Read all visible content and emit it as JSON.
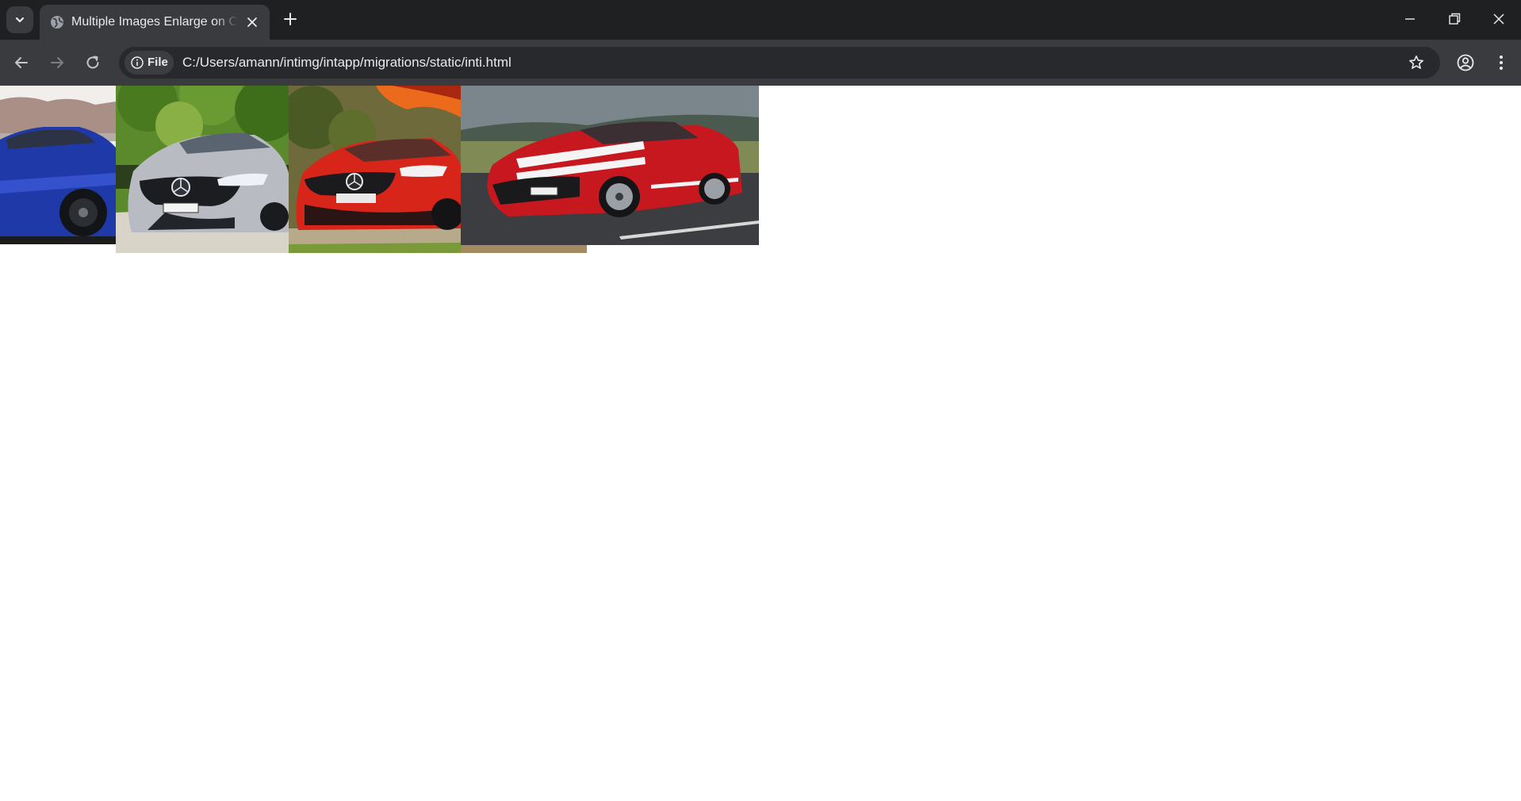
{
  "browser": {
    "tab_title": "Multiple Images Enlarge on Click",
    "address_chip_label": "File",
    "url": "C:/Users/amann/intimg/intapp/migrations/static/inti.html",
    "icons": [
      "chevron-down-icon",
      "globe-icon",
      "close-icon",
      "plus-icon",
      "minimize-icon",
      "restore-icon",
      "window-close-icon",
      "arrow-left-icon",
      "arrow-right-icon",
      "reload-icon",
      "info-icon",
      "star-icon",
      "account-icon",
      "more-vert-icon"
    ]
  },
  "page": {
    "images": [
      {
        "name": "blue-sedan",
        "color": "#1f3aa8"
      },
      {
        "name": "silver-mercedes-amg",
        "color": "#b8bcc2"
      },
      {
        "name": "red-mercedes",
        "color": "#d8251a"
      },
      {
        "name": "red-mustang",
        "color": "#c8181f"
      }
    ]
  }
}
